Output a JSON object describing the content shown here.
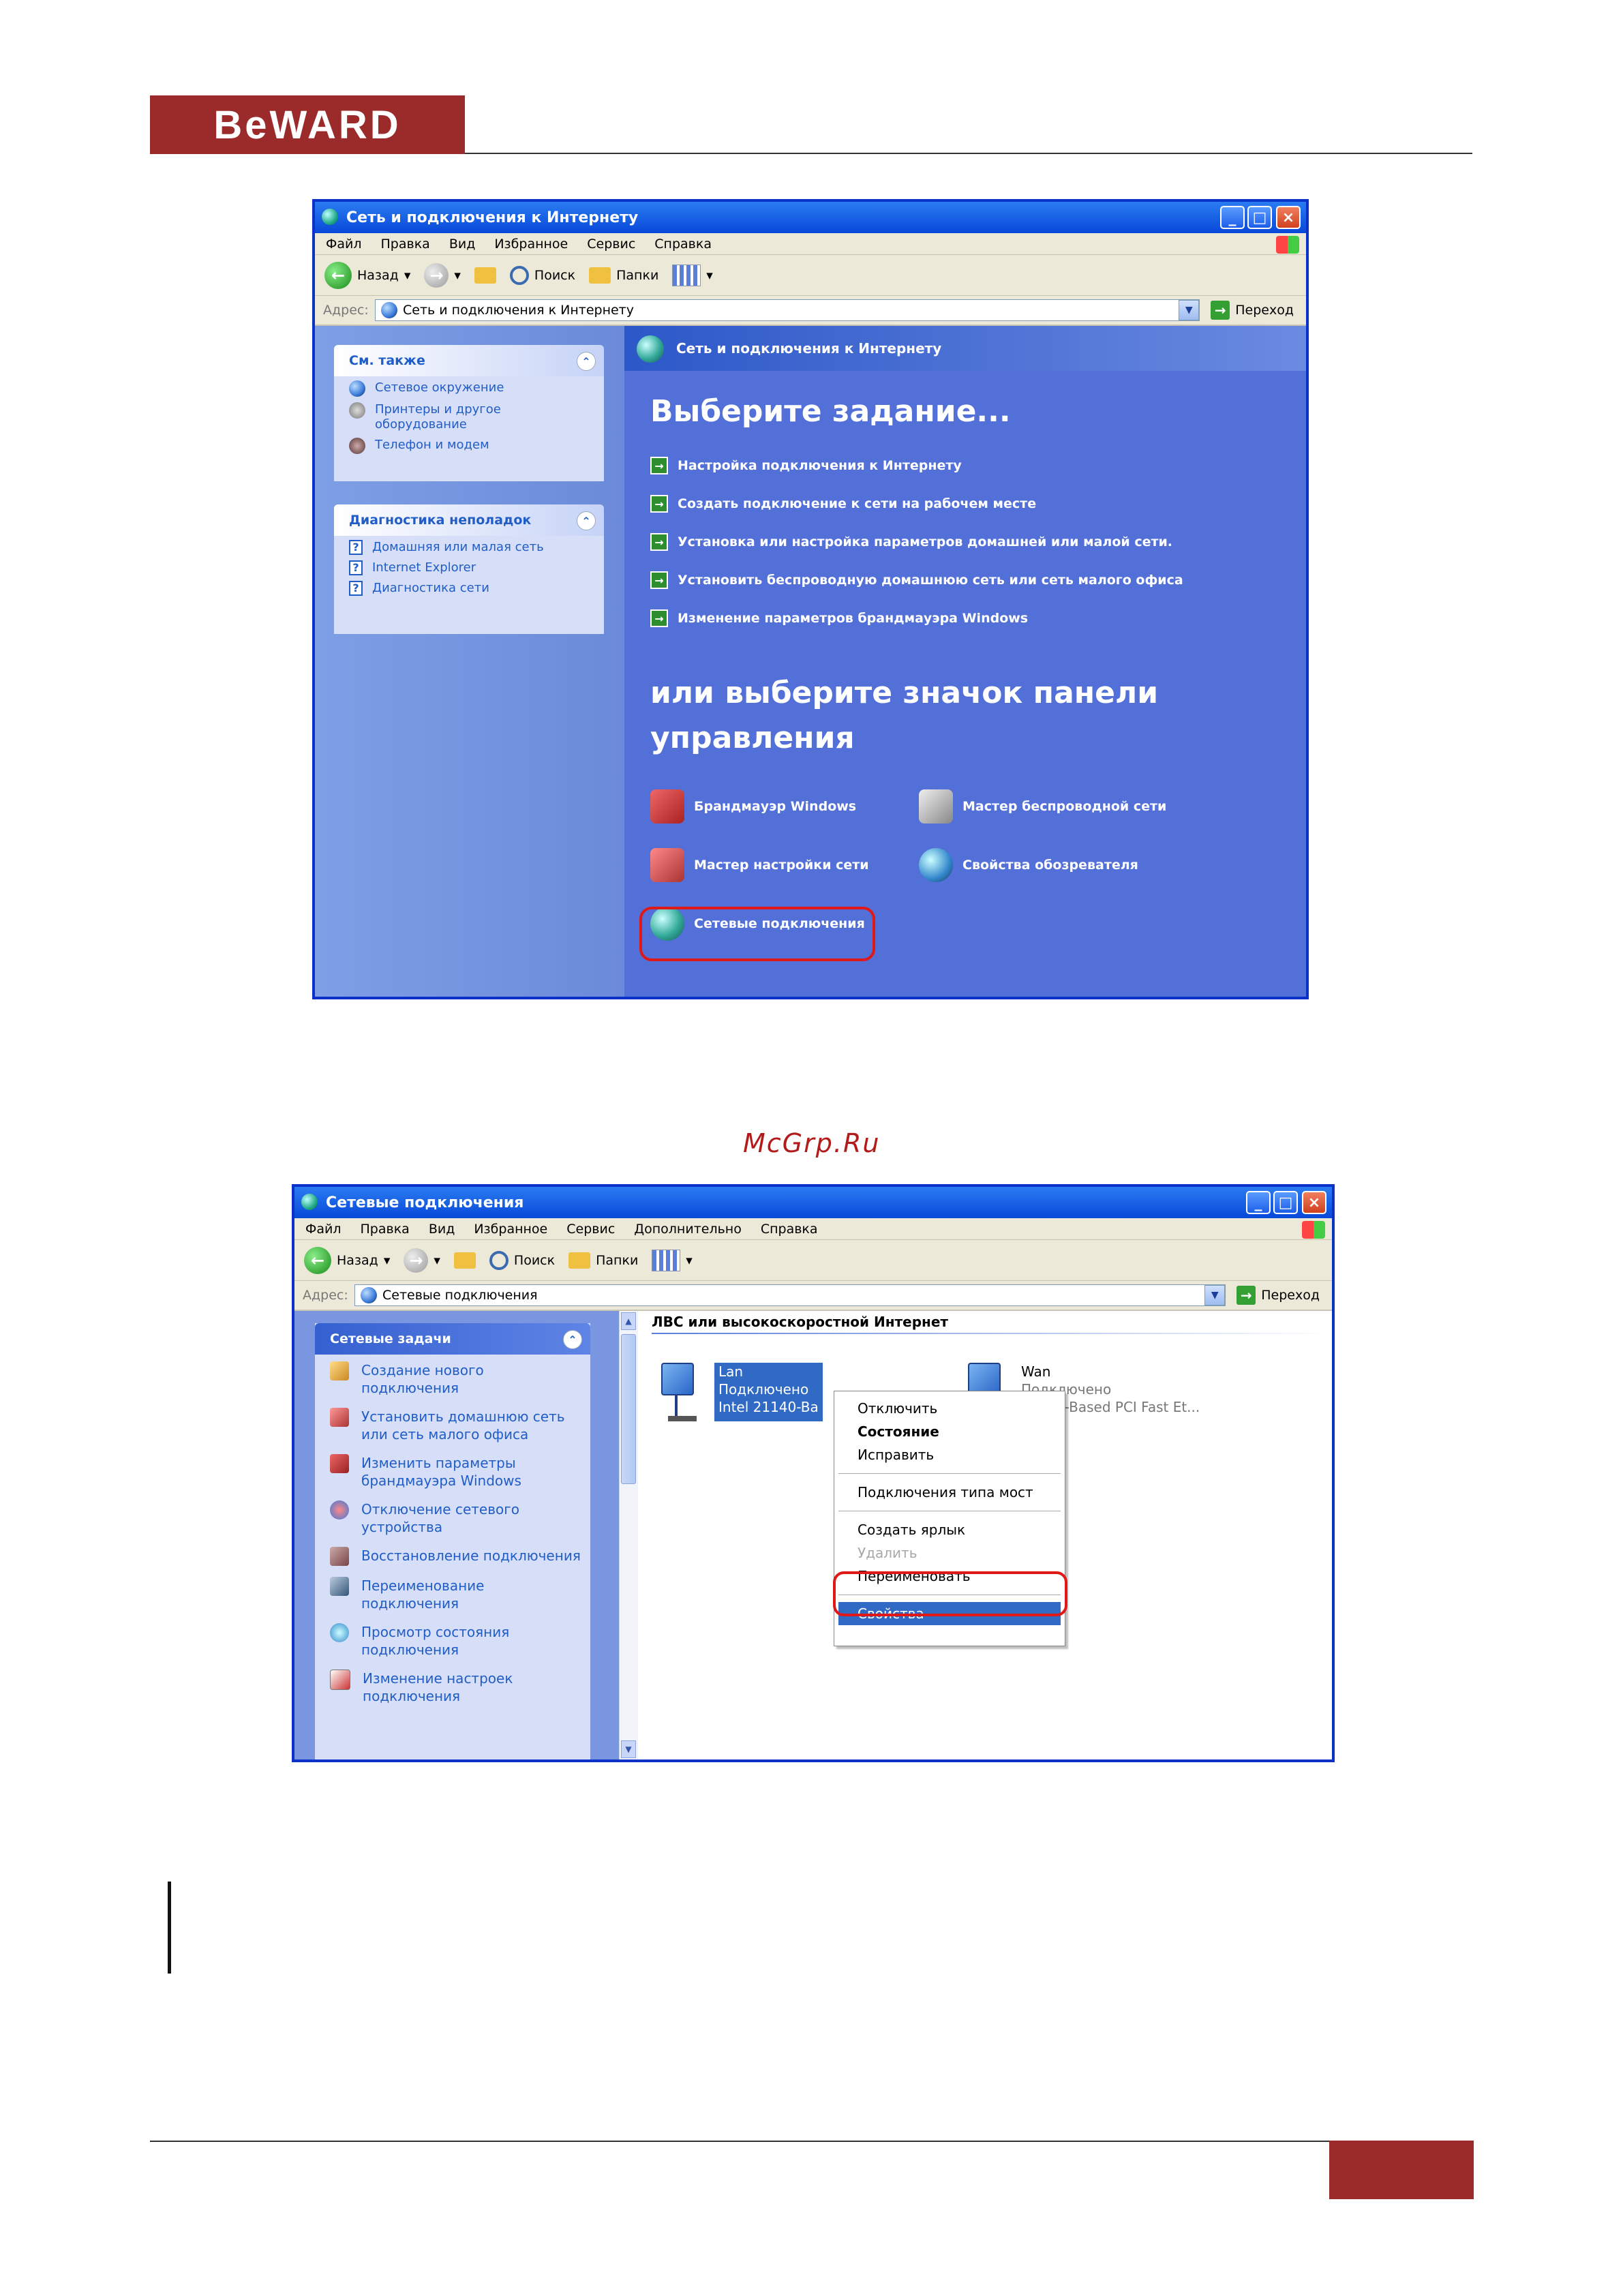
{
  "page": {
    "logo_text": "BeWARD",
    "watermark": "McGrp.Ru"
  },
  "window1": {
    "title": "Сеть и подключения к Интернету",
    "menu": [
      "Файл",
      "Правка",
      "Вид",
      "Избранное",
      "Сервис",
      "Справка"
    ],
    "toolbar": {
      "back": "Назад",
      "search": "Поиск",
      "folders": "Папки"
    },
    "address": {
      "label": "Адрес:",
      "value": "Сеть и подключения к Интернету",
      "go": "Переход"
    },
    "see_also": {
      "title": "См. также",
      "items": [
        "Сетевое окружение",
        "Принтеры и другое оборудование",
        "Телефон и модем"
      ]
    },
    "troubleshoot": {
      "title": "Диагностика неполадок",
      "items": [
        "Домашняя или малая сеть",
        "Internet Explorer",
        "Диагностика сети"
      ]
    },
    "header": "Сеть и подключения к Интернету",
    "pick_task": "Выберите задание...",
    "tasks": [
      "Настройка подключения к Интернету",
      "Создать подключение к сети на рабочем месте",
      "Установка или настройка параметров домашней или малой сети.",
      "Установить беспроводную домашнюю сеть или сеть малого офиса",
      "Изменение параметров брандмауэра Windows"
    ],
    "pick_icon": "или выберите значок панели управления",
    "icons": [
      "Брандмауэр Windows",
      "Мастер беспроводной сети",
      "Мастер настройки сети",
      "Свойства обозревателя",
      "Сетевые подключения"
    ]
  },
  "window2": {
    "title": "Сетевые подключения",
    "menu": [
      "Файл",
      "Правка",
      "Вид",
      "Избранное",
      "Сервис",
      "Дополнительно",
      "Справка"
    ],
    "toolbar": {
      "back": "Назад",
      "search": "Поиск",
      "folders": "Папки"
    },
    "address": {
      "label": "Адрес:",
      "value": "Сетевые подключения",
      "go": "Переход"
    },
    "tasks_panel": {
      "title": "Сетевые задачи",
      "items": [
        "Создание нового подключения",
        "Установить домашнюю сеть или сеть малого офиса",
        "Изменить параметры брандмауэра Windows",
        "Отключение сетевого устройства",
        "Восстановление подключения",
        "Переименование подключения",
        "Просмотр состояния подключения",
        "Изменение настроек подключения"
      ]
    },
    "group_header": "ЛВС или высокоскоростной Интернет",
    "lan": {
      "name": "Lan",
      "status": "Подключено",
      "device": "Intel 21140-Ba"
    },
    "wan": {
      "name": "Wan",
      "status": "Подключено",
      "device": "21140-Based PCI Fast Et..."
    },
    "context_menu": [
      "Отключить",
      "Состояние",
      "Исправить",
      "Подключения типа мост",
      "Создать ярлык",
      "Удалить",
      "Переименовать",
      "Свойства"
    ]
  }
}
